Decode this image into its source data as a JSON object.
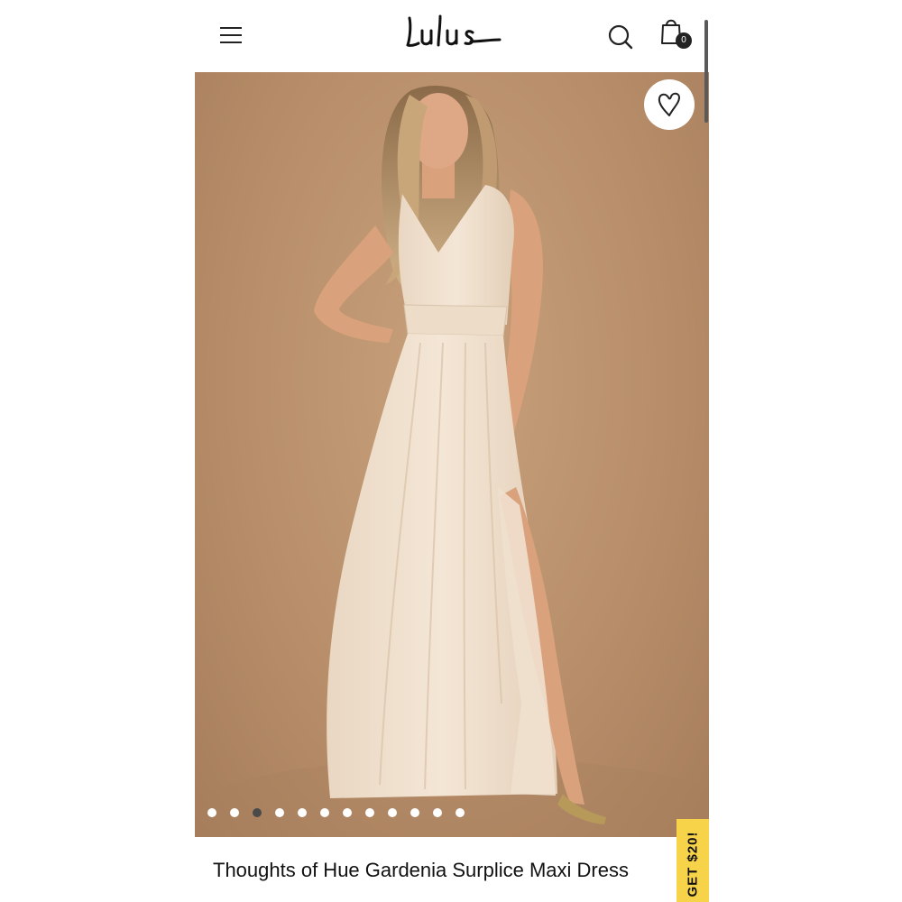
{
  "header": {
    "logo_text": "Lulus",
    "bag_count": "0"
  },
  "product": {
    "title": "Thoughts of Hue Gardenia Surplice Maxi Dress",
    "image_count": 12,
    "active_image_index": 2
  },
  "promo": {
    "label": "GET $20!"
  },
  "colors": {
    "background": "#b98f6b",
    "dress": "#f1e2d0",
    "promo": "#f7d34a"
  },
  "icons": [
    "menu-icon",
    "search-icon",
    "shopping-bag-icon",
    "heart-icon"
  ]
}
